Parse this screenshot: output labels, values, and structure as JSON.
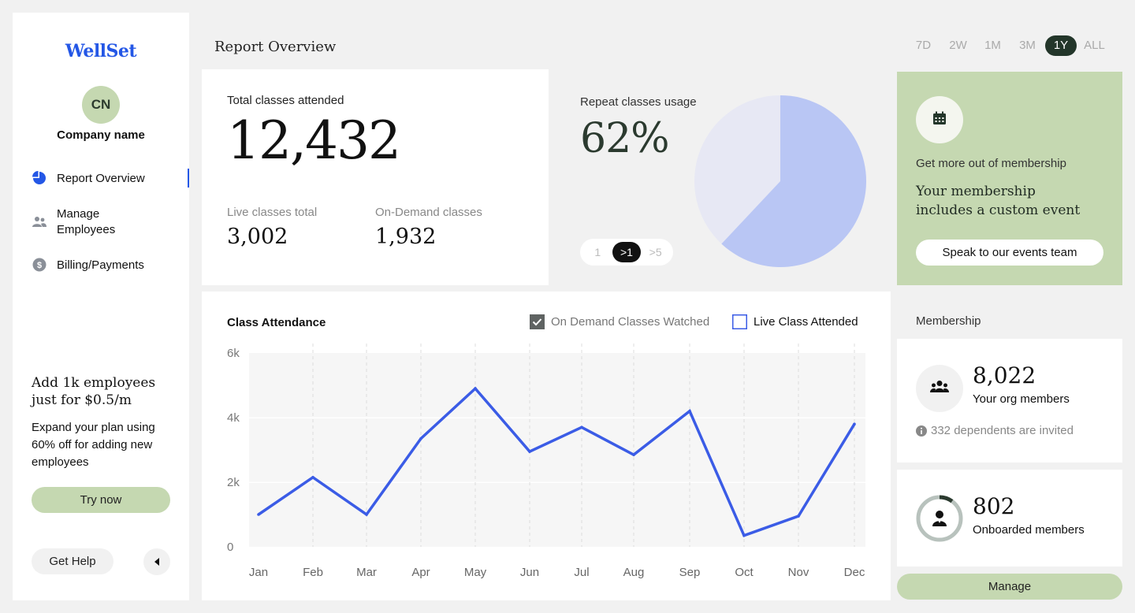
{
  "brand": {
    "name": "WellSet",
    "color": "#2457e6"
  },
  "company": {
    "initials": "CN",
    "name": "Company name"
  },
  "sidebar": {
    "items": [
      {
        "label": "Report Overview",
        "icon": "pie-chart-icon",
        "active": true
      },
      {
        "label": "Manage Employees",
        "line1": "Manage",
        "line2": "Employees",
        "icon": "people-icon",
        "active": false
      },
      {
        "label": "Billing/Payments",
        "icon": "dollar-coin-icon",
        "active": false
      }
    ],
    "promo": {
      "title": "Add 1k employees just for $0.5/m",
      "text": "Expand your plan using 60% off for adding new employees",
      "button": "Try now"
    },
    "help": "Get Help"
  },
  "header": {
    "title": "Report Overview",
    "ranges": [
      "7D",
      "2W",
      "1M",
      "3M",
      "1Y",
      "ALL"
    ],
    "active_range": "1Y"
  },
  "totals": {
    "label": "Total classes attended",
    "value": "12,432",
    "live_label": "Live classes total",
    "live_value": "3,002",
    "ondemand_label": "On-Demand classes",
    "ondemand_value": "1,932"
  },
  "repeat": {
    "label": "Repeat classes usage",
    "value": "62%",
    "percent": 62,
    "filters": [
      "1",
      ">1",
      ">5"
    ],
    "active_filter": ">1",
    "colors": {
      "used": "#b9c6f4",
      "rest": "#e7e8f4"
    }
  },
  "promo_card": {
    "subtitle": "Get more out of membership",
    "title_line1": "Your membership",
    "title_line2": "includes a custom event",
    "button": "Speak to our events team"
  },
  "attendance": {
    "title": "Class Attendance",
    "legend": [
      {
        "label": "On Demand Classes Watched",
        "checked": true
      },
      {
        "label": "Live Class Attended",
        "checked": false
      }
    ]
  },
  "chart_data": {
    "type": "line",
    "title": "Class Attendance",
    "categories": [
      "Jan",
      "Feb",
      "Mar",
      "Apr",
      "May",
      "Jun",
      "Jul",
      "Aug",
      "Sep",
      "Oct",
      "Nov",
      "Dec"
    ],
    "values": [
      1000,
      2150,
      1000,
      3350,
      4900,
      2950,
      3700,
      2850,
      4200,
      350,
      950,
      3800
    ],
    "yticks": [
      "0",
      "2k",
      "4k",
      "6k"
    ],
    "ylim": [
      0,
      6000
    ],
    "color": "#3b5ce6",
    "grid": true
  },
  "membership": {
    "label": "Membership",
    "org_value": "8,022",
    "org_label": "Your org members",
    "dependents": "332 dependents are invited",
    "onboard_value": "802",
    "onboard_label": "Onboarded members",
    "onboard_fraction": 0.1,
    "manage": "Manage"
  }
}
